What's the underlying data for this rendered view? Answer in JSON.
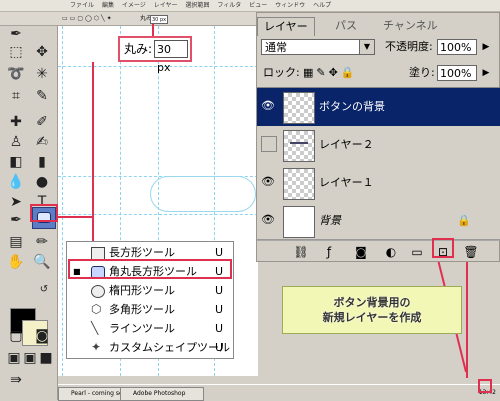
{
  "menubar": {
    "items": [
      "ファイル",
      "編集",
      "イメージ",
      "レイヤー",
      "選択範囲",
      "フィルタ",
      "ビュー",
      "ウィンドウ",
      "ヘルプ"
    ]
  },
  "options": {
    "radius_label": "丸み:",
    "radius_value": "30 px"
  },
  "radius_callout": {
    "label": "丸み:",
    "value": "30 px"
  },
  "tool_flyout": {
    "items": [
      {
        "label": "長方形ツール",
        "key": "U"
      },
      {
        "label": "角丸長方形ツール",
        "key": "U"
      },
      {
        "label": "楕円形ツール",
        "key": "U"
      },
      {
        "label": "多角形ツール",
        "key": "U"
      },
      {
        "label": "ラインツール",
        "key": "U"
      },
      {
        "label": "カスタムシェイプツール",
        "key": "U"
      }
    ],
    "selected_marker": "■"
  },
  "layers_panel": {
    "tabs": [
      "レイヤー",
      "パス",
      "チャンネル"
    ],
    "blend_mode": "通常",
    "opacity_label": "不透明度:",
    "opacity_value": "100%",
    "lock_label": "ロック:",
    "fill_label": "塗り:",
    "fill_value": "100%",
    "layers": [
      {
        "name": "ボタンの背景"
      },
      {
        "name": "レイヤー２"
      },
      {
        "name": "レイヤー１"
      },
      {
        "name": "背景"
      }
    ]
  },
  "note": {
    "line1": "ボタン背景用の",
    "line2": "新規レイヤーを作成"
  },
  "taskbar": {
    "task1": "Pearl - coming soon -",
    "task2": "Adobe Photoshop",
    "time": "13:42"
  },
  "colors": {
    "accent_red": "#e03050",
    "selected_layer": "#0a246a",
    "note_bg": "#f3f7b5",
    "foreground": "#000000",
    "background": "#f4f1c8"
  }
}
